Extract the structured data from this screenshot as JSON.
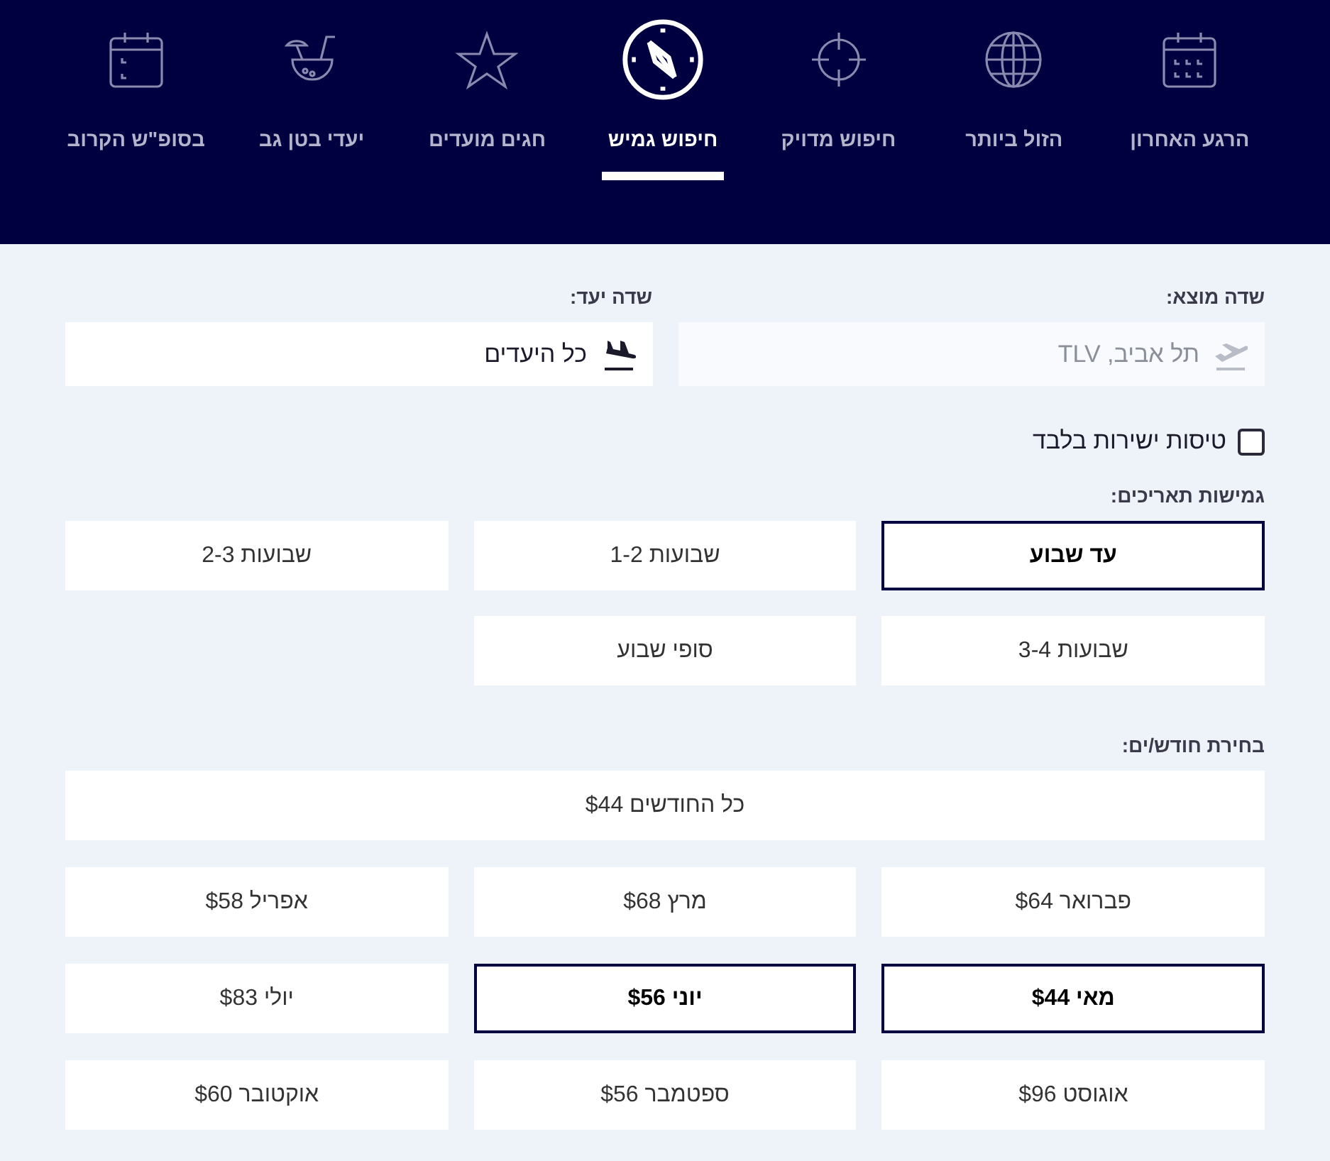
{
  "tabs": [
    {
      "label": "הרגע האחרון",
      "kind": "calendar-grid",
      "selected": false
    },
    {
      "label": "הזול ביותר",
      "kind": "globe",
      "selected": false
    },
    {
      "label": "חיפוש מדויק",
      "kind": "crosshair",
      "selected": false
    },
    {
      "label": "חיפוש גמיש",
      "kind": "compass",
      "selected": true
    },
    {
      "label": "חגים מועדים",
      "kind": "star",
      "selected": false
    },
    {
      "label": "יעדי בטן גב",
      "kind": "drink",
      "selected": false
    },
    {
      "label": "בסופ\"ש הקרוב",
      "kind": "calendar",
      "selected": false
    }
  ],
  "origin": {
    "label": "שדה מוצא:",
    "value": "תל אביב, TLV",
    "disabled": true
  },
  "destination": {
    "label": "שדה יעד:",
    "value": "כל היעדים",
    "disabled": false
  },
  "direct_only": {
    "label": "טיסות ישירות בלבד",
    "checked": false
  },
  "durations": {
    "label": "גמישות תאריכים:",
    "options": [
      {
        "label": "עד שבוע",
        "selected": true
      },
      {
        "label": "שבועות 1-2",
        "selected": false
      },
      {
        "label": "שבועות 2-3",
        "selected": false
      },
      {
        "label": "שבועות 3-4",
        "selected": false
      },
      {
        "label": "סופי שבוע",
        "selected": false
      }
    ]
  },
  "months": {
    "label": "בחירת חודש/ים:",
    "all": {
      "label": "כל החודשים $44",
      "selected": false
    },
    "options": [
      {
        "label": "פברואר $64",
        "selected": false
      },
      {
        "label": "מרץ $68",
        "selected": false
      },
      {
        "label": "אפריל $58",
        "selected": false
      },
      {
        "label": "מאי $44",
        "selected": true
      },
      {
        "label": "יוני $56",
        "selected": true
      },
      {
        "label": "יולי $83",
        "selected": false
      },
      {
        "label": "אוגוסט $96",
        "selected": false
      },
      {
        "label": "ספטמבר $56",
        "selected": false
      },
      {
        "label": "אוקטובר $60",
        "selected": false
      }
    ]
  }
}
